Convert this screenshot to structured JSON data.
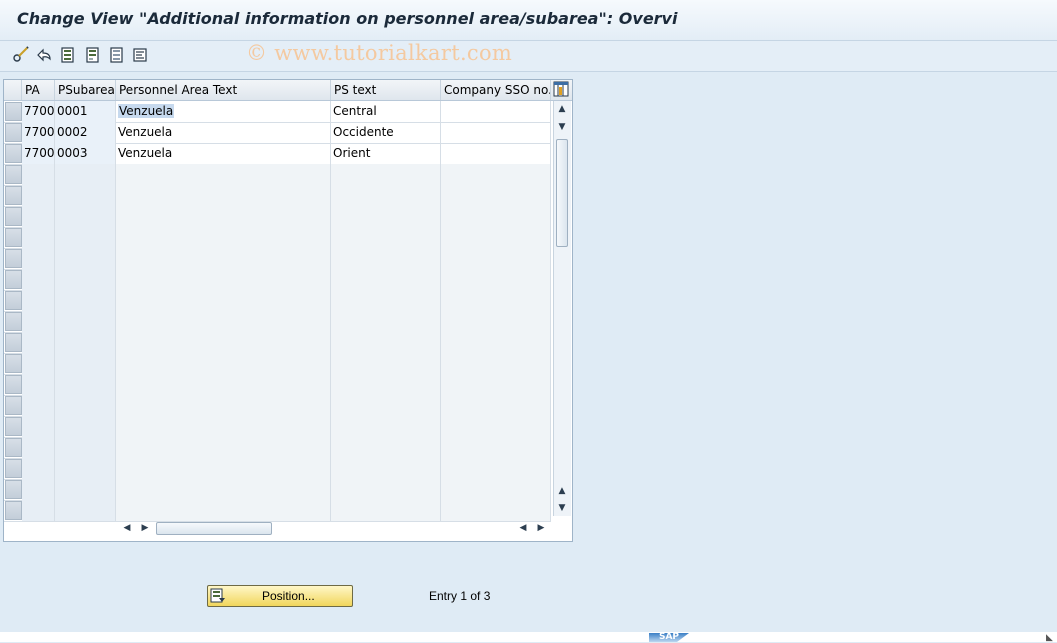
{
  "window": {
    "title": "Change View \"Additional information on personnel area/subarea\": Overvi"
  },
  "watermark": "© www.tutorialkart.com",
  "toolbar": {
    "buttons": [
      {
        "icon": "pencil-glasses-icon"
      },
      {
        "icon": "undo-icon"
      },
      {
        "icon": "select-all-icon"
      },
      {
        "icon": "select-block-icon"
      },
      {
        "icon": "deselect-all-icon"
      },
      {
        "icon": "list-icon"
      }
    ]
  },
  "table": {
    "columns": [
      "PA",
      "PSubarea",
      "Personnel Area Text",
      "PS text",
      "Company SSO no."
    ],
    "rows": [
      {
        "pa": "7700",
        "psubarea": "0001",
        "area_text": "Venzuela",
        "ps_text": "Central",
        "sso": ""
      },
      {
        "pa": "7700",
        "psubarea": "0002",
        "area_text": "Venzuela",
        "ps_text": "Occidente",
        "sso": ""
      },
      {
        "pa": "7700",
        "psubarea": "0003",
        "area_text": "Venzuela",
        "ps_text": "Orient",
        "sso": ""
      }
    ],
    "empty_rows": 17
  },
  "footer": {
    "position_label": "Position...",
    "entry_info": "Entry 1 of 3"
  },
  "status": {
    "logo": "SAP"
  },
  "colors": {
    "accent_button": "#f1d65c",
    "background": "#dfebf5"
  }
}
